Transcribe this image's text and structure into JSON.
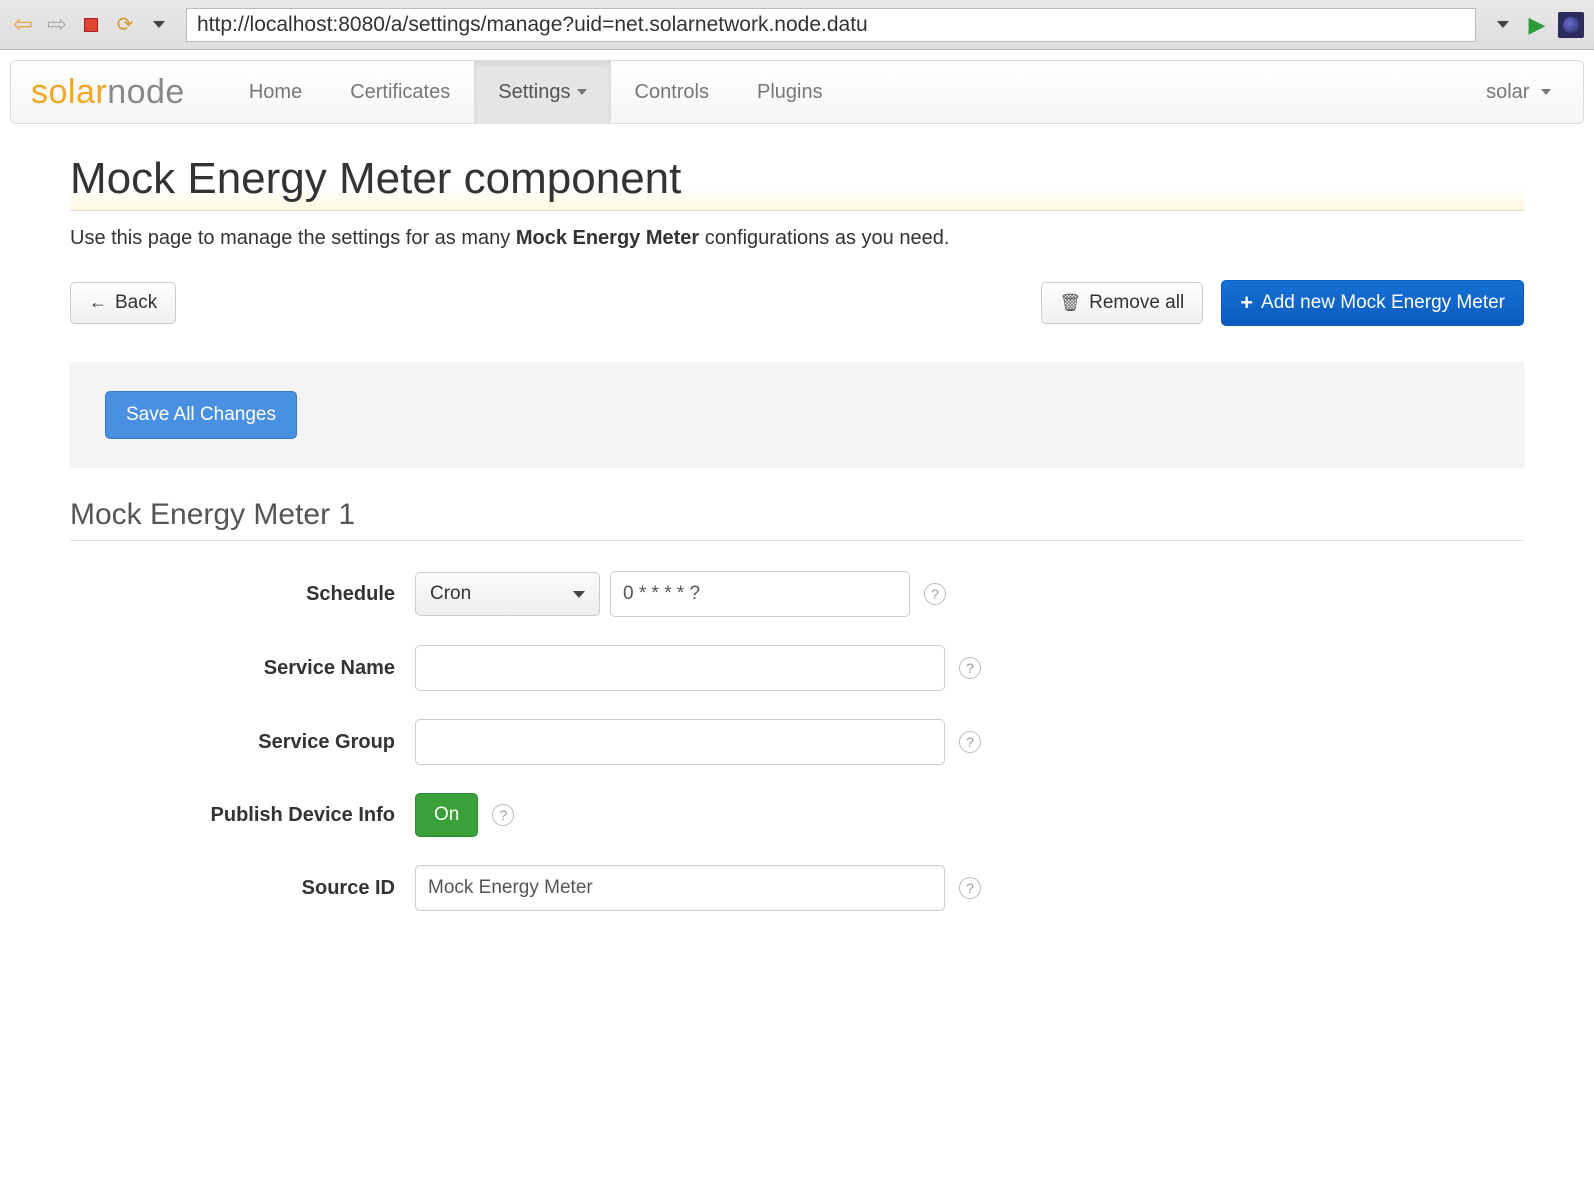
{
  "browser": {
    "url": "http://localhost:8080/a/settings/manage?uid=net.solarnetwork.node.datu"
  },
  "brand": {
    "part1": "solar",
    "part2": "node"
  },
  "nav": {
    "home": "Home",
    "certificates": "Certificates",
    "settings": "Settings",
    "controls": "Controls",
    "plugins": "Plugins",
    "user": "solar"
  },
  "page": {
    "title": "Mock Energy Meter component",
    "desc_pre": "Use this page to manage the settings for as many ",
    "desc_bold": "Mock Energy Meter",
    "desc_post": " configurations as you need."
  },
  "actions": {
    "back": "Back",
    "remove_all": "Remove all",
    "add_new": "Add new Mock Energy Meter",
    "save_all": "Save All Changes"
  },
  "section": {
    "heading": "Mock Energy Meter 1"
  },
  "form": {
    "schedule_label": "Schedule",
    "schedule_mode": "Cron",
    "schedule_value": "0 * * * * ?",
    "service_name_label": "Service Name",
    "service_name_value": "",
    "service_group_label": "Service Group",
    "service_group_value": "",
    "publish_label": "Publish Device Info",
    "publish_value": "On",
    "source_id_label": "Source ID",
    "source_id_value": "Mock Energy Meter"
  }
}
